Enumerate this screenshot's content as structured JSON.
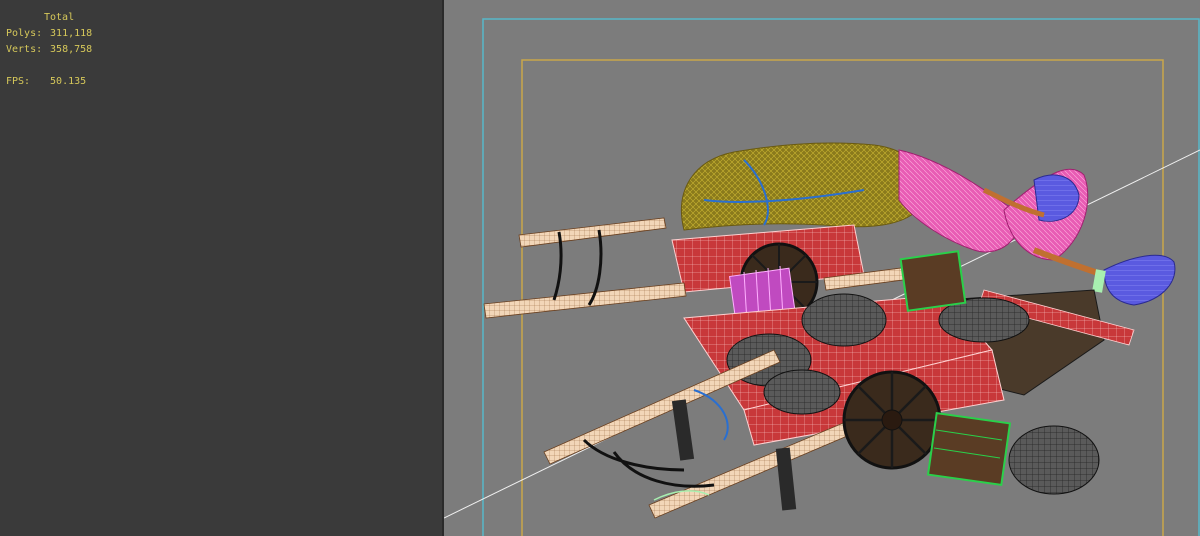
{
  "stats": {
    "header": "Total",
    "polys_label": "Polys:",
    "polys_value": "311,118",
    "verts_label": "Verts:",
    "verts_value": "358,758",
    "fps_label": "FPS:",
    "fps_value": "50.135"
  },
  "colors": {
    "stats_text": "#d6c85a",
    "panel_bg": "#3a3a3a",
    "viewport_bg": "#7c7c7c",
    "safe_frame_outer": "#56b8c9",
    "safe_frame_inner": "#c9a64a"
  },
  "scene": {
    "objects": [
      "cart-rear",
      "cart-front",
      "hay-load",
      "brooms",
      "sacks",
      "wheels",
      "crates",
      "poles"
    ]
  }
}
